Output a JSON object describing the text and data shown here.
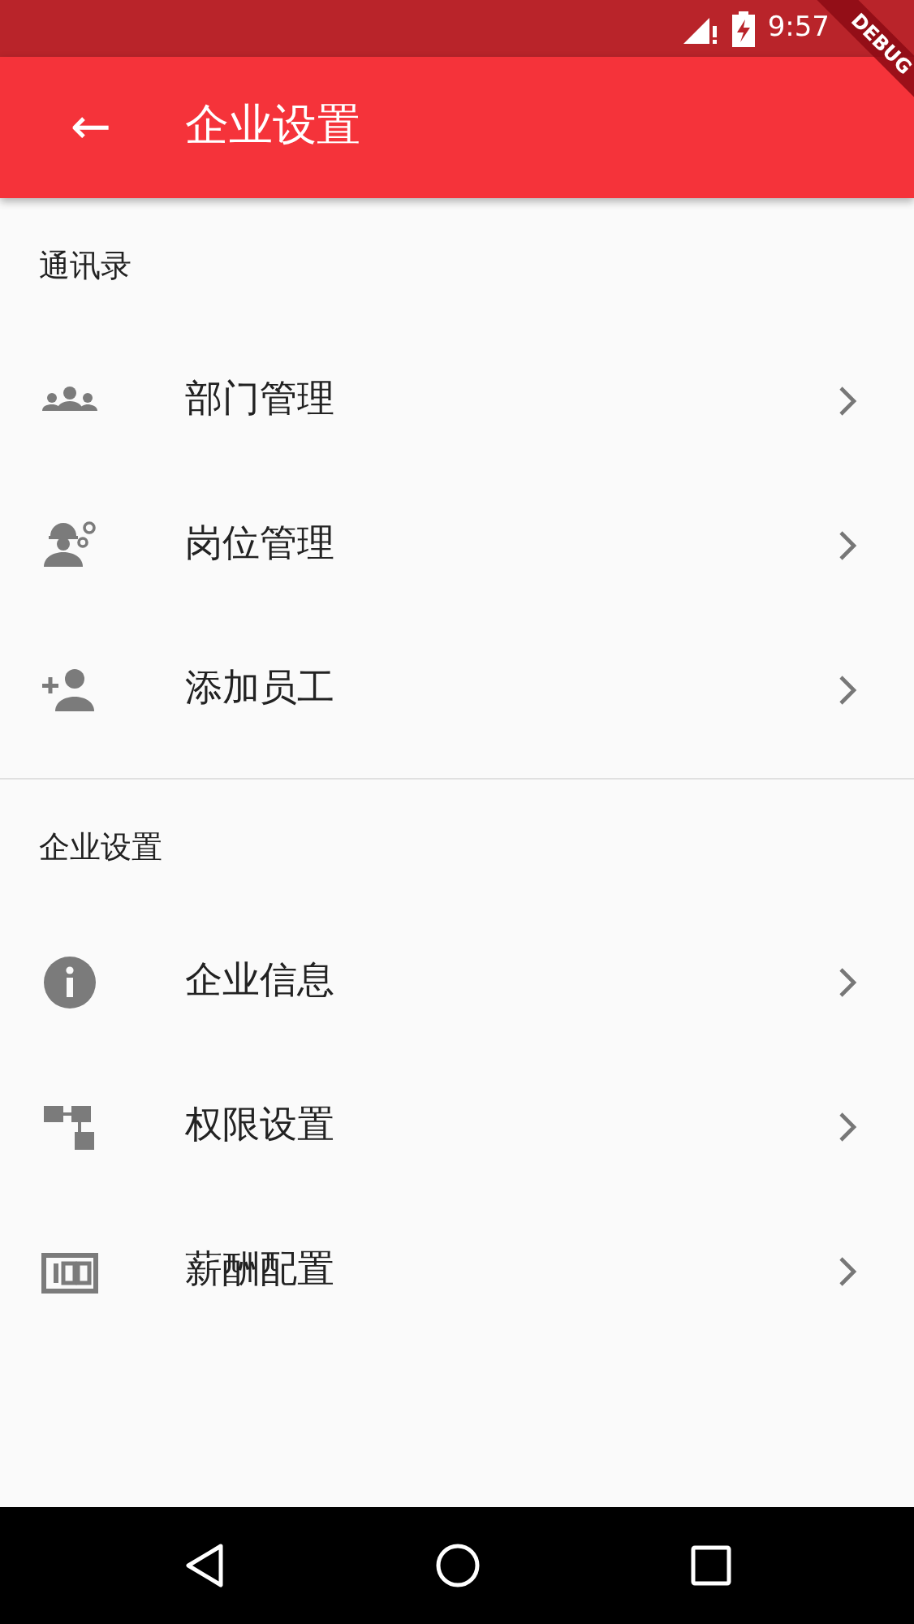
{
  "status_bar": {
    "time": "9:57"
  },
  "debug_banner": "DEBUG",
  "app_bar": {
    "back_icon": "←",
    "title": "企业设置"
  },
  "sections": [
    {
      "header": "通讯录",
      "items": [
        {
          "kind": "group",
          "label": "部门管理"
        },
        {
          "kind": "worker",
          "label": "岗位管理"
        },
        {
          "kind": "addperson",
          "label": "添加员工"
        }
      ]
    },
    {
      "header": "企业设置",
      "items": [
        {
          "kind": "info",
          "label": "企业信息"
        },
        {
          "kind": "tree",
          "label": "权限设置"
        },
        {
          "kind": "counter",
          "label": "薪酬配置"
        }
      ]
    }
  ]
}
